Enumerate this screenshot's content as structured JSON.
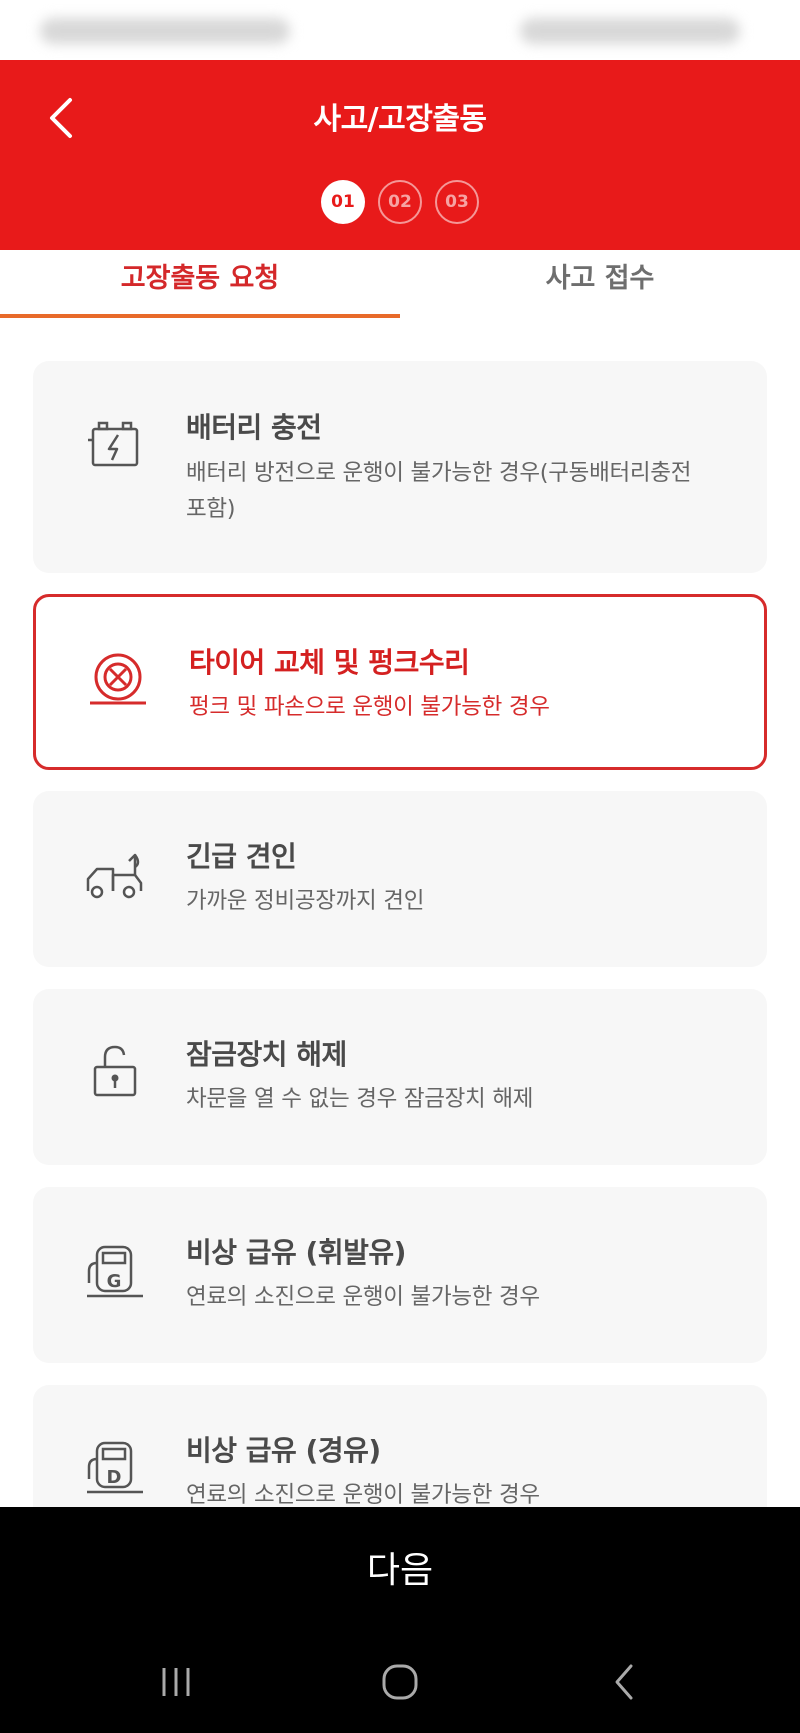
{
  "header": {
    "title": "사고/고장출동",
    "steps": [
      "01",
      "02",
      "03"
    ],
    "active_step": 0
  },
  "tabs": [
    {
      "label": "고장출동 요청",
      "active": true
    },
    {
      "label": "사고 접수",
      "active": false
    }
  ],
  "services": [
    {
      "icon": "battery-icon",
      "title": "배터리 충전",
      "desc": "배터리 방전으로 운행이 불가능한 경우(구동배터리충전 포함)",
      "selected": false
    },
    {
      "icon": "tire-icon",
      "title": "타이어 교체 및 펑크수리",
      "desc": "펑크 및 파손으로 운행이 불가능한 경우",
      "selected": true
    },
    {
      "icon": "tow-truck-icon",
      "title": "긴급 견인",
      "desc": "가까운 정비공장까지 견인",
      "selected": false
    },
    {
      "icon": "unlock-icon",
      "title": "잠금장치 해제",
      "desc": "차문을 열 수 없는 경우 잠금장치 해제",
      "selected": false
    },
    {
      "icon": "gas-pump-g-icon",
      "title": "비상 급유 (휘발유)",
      "desc": "연료의 소진으로 운행이 불가능한 경우",
      "selected": false
    },
    {
      "icon": "gas-pump-d-icon",
      "title": "비상 급유 (경유)",
      "desc": "연료의 소진으로 운행이 불가능한 경우",
      "selected": false
    }
  ],
  "next_button": {
    "label": "다음"
  },
  "colors": {
    "brand_red": "#e81a1a",
    "selected_red": "#d62b2b",
    "tab_underline": "#e86a2a"
  }
}
